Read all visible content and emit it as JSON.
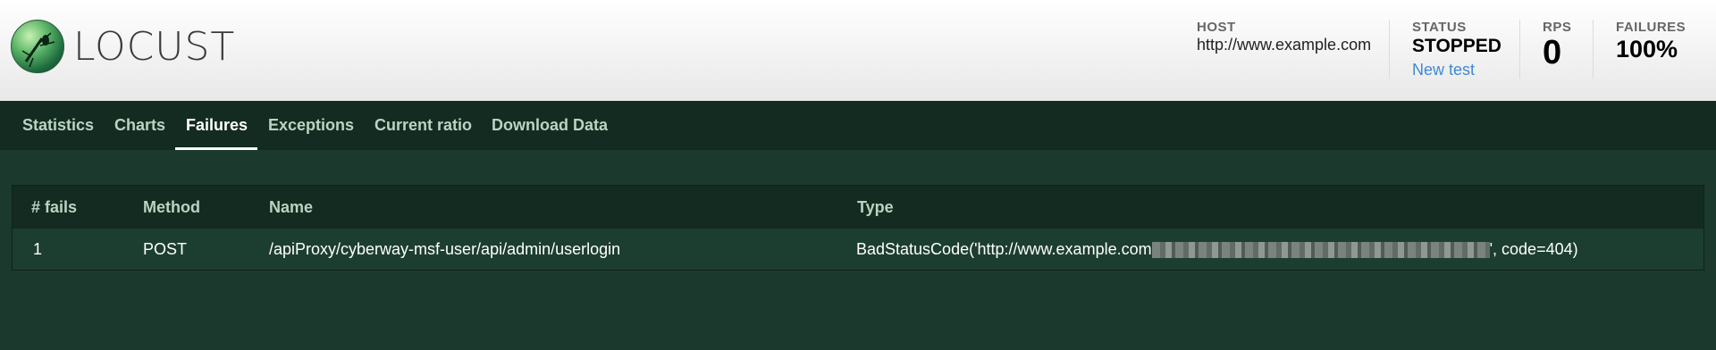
{
  "app": {
    "logo_text": "LOCUST"
  },
  "header": {
    "host": {
      "label": "HOST",
      "value": "http://www.example.com"
    },
    "status": {
      "label": "STATUS",
      "value": "STOPPED",
      "link": "New test"
    },
    "rps": {
      "label": "RPS",
      "value": "0"
    },
    "failures": {
      "label": "FAILURES",
      "value": "100%"
    }
  },
  "nav": {
    "tabs": [
      {
        "label": "Statistics"
      },
      {
        "label": "Charts"
      },
      {
        "label": "Failures"
      },
      {
        "label": "Exceptions"
      },
      {
        "label": "Current ratio"
      },
      {
        "label": "Download Data"
      }
    ],
    "active": "Failures"
  },
  "failures_table": {
    "columns": [
      "# fails",
      "Method",
      "Name",
      "Type"
    ],
    "rows": [
      {
        "fails": "1",
        "method": "POST",
        "name": "/apiProxy/cyberway-msf-user/api/admin/userlogin",
        "type_prefix": "BadStatusCode('http://www.example.com",
        "type_suffix": "', code=404)"
      }
    ]
  },
  "colors": {
    "header_bg": "#f0f0f0",
    "nav_bg": "#132b20",
    "body_bg": "#1b3a2d",
    "row_bg": "#1c3e30",
    "link": "#3d8ad6"
  },
  "icons": {
    "logo": "locust-logo-icon"
  }
}
